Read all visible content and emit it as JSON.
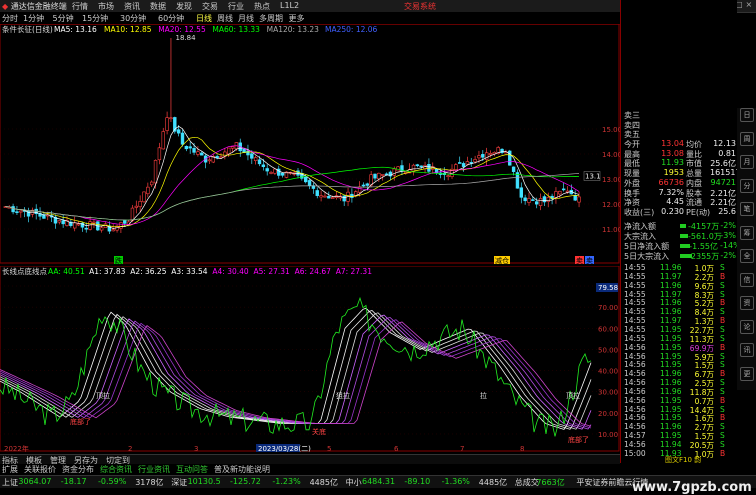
{
  "app": {
    "title": "通达信金融终端",
    "trade_button": "交易系统"
  },
  "menu": [
    "行情",
    "市场",
    "资讯",
    "数据",
    "发现",
    "交易",
    "行业",
    "热点",
    "L1L2"
  ],
  "periods": [
    "分时",
    "1分钟",
    "5分钟",
    "15分钟",
    "30分钟",
    "60分钟",
    "日线",
    "周线",
    "月线",
    "多周期",
    "更多"
  ],
  "active_period": "日线",
  "main_chart": {
    "title": "条件长征(日线)",
    "ma_labels": [
      {
        "text": "MA5: 13.16",
        "color": "#ffffff"
      },
      {
        "text": "MA10: 12.85",
        "color": "#ffff00"
      },
      {
        "text": "MA20: 12.55",
        "color": "#ff00ff"
      },
      {
        "text": "MA60: 13.33",
        "color": "#00ff00"
      },
      {
        "text": "MA120: 13.23",
        "color": "#aaaaaa"
      },
      {
        "text": "MA250: 12.06",
        "color": "#4060ff"
      }
    ],
    "price_axis": [
      "15.00",
      "14.00",
      "13.00",
      "12.00",
      "11.00"
    ],
    "high_label": "18.84",
    "low_label": "9.79",
    "current_price_tag": "13.1",
    "markers": [
      {
        "text": "跌",
        "color": "#00cc00"
      },
      {
        "text": "减仓",
        "color": "#ffcc00"
      },
      {
        "text": "卖",
        "color": "#ff3333"
      },
      {
        "text": "卖",
        "color": "#3366ff"
      }
    ]
  },
  "indicator": {
    "title": "长线点底线点",
    "labels": [
      {
        "text": "AA: 40.51",
        "color": "#00ff00"
      },
      {
        "text": "A1: 37.83",
        "color": "#ffffff"
      },
      {
        "text": "A2: 36.25",
        "color": "#ffffff"
      },
      {
        "text": "A3: 33.54",
        "color": "#ffffff"
      },
      {
        "text": "A4: 30.40",
        "color": "#ff00ff"
      },
      {
        "text": "A5: 27.31",
        "color": "#ff00ff"
      },
      {
        "text": "A6: 24.67",
        "color": "#ff00ff"
      },
      {
        "text": "A7: 27.31",
        "color": "#ff00ff"
      }
    ],
    "axis": [
      "80.00",
      "70.00",
      "60.00",
      "50.00",
      "40.00",
      "30.00",
      "20.00",
      "10.00"
    ],
    "value_tag": "79.58",
    "annotations": [
      "顶拉",
      "狙拉",
      "拉",
      "顶拉",
      "底部了",
      "关底",
      "底部了"
    ]
  },
  "time_axis": [
    "2022年",
    "2",
    "3",
    "4",
    "2023/03/28(二)",
    "5",
    "6",
    "7",
    "8"
  ],
  "right_panel": {
    "order_book": [
      "卖三",
      "卖四",
      "卖五"
    ],
    "quote": [
      {
        "l": "今开",
        "v1": "13.04",
        "c1": "red",
        "l2": "均价",
        "v2": "12.13",
        "c2": "white"
      },
      {
        "l": "最高",
        "v1": "13.08",
        "c1": "red",
        "l2": "量比",
        "v2": "0.81",
        "c2": "white"
      },
      {
        "l": "最低",
        "v1": "11.93",
        "c1": "green",
        "l2": "市值",
        "v2": "25.6亿",
        "c2": "white"
      },
      {
        "l": "现量",
        "v1": "1953",
        "c1": "yellow",
        "l2": "总量",
        "v2": "161517",
        "c2": "white"
      },
      {
        "l": "外盘",
        "v1": "66736",
        "c1": "red",
        "l2": "内盘",
        "v2": "94721",
        "c2": "green"
      },
      {
        "l": "换手",
        "v1": "7.32%",
        "c1": "white",
        "l2": "股本",
        "v2": "2.21亿",
        "c2": "white"
      },
      {
        "l": "净资",
        "v1": "4.45",
        "c1": "white",
        "l2": "流通",
        "v2": "2.21亿",
        "c2": "white"
      },
      {
        "l": "收益(三)",
        "v1": "0.230",
        "c1": "white",
        "l2": "PE(动)",
        "v2": "25.6",
        "c2": "white"
      }
    ],
    "capital": [
      {
        "l": "净流入额",
        "v": "-4157万",
        "p": "-2%"
      },
      {
        "l": "大宗流入",
        "v": "-561.0万",
        "p": "-3%"
      },
      {
        "l": "5日净流入额",
        "v": "-1.55亿",
        "p": "-14%"
      },
      {
        "l": "5日大宗流入",
        "v": "-2355万",
        "p": "-2%"
      }
    ],
    "ticks": [
      {
        "t": "14:55",
        "p": "11.96",
        "v": "1.0万",
        "d": "S"
      },
      {
        "t": "14:55",
        "p": "11.97",
        "v": "2.2万",
        "d": "B"
      },
      {
        "t": "14:55",
        "p": "11.96",
        "v": "9.6万",
        "d": "S"
      },
      {
        "t": "14:55",
        "p": "11.97",
        "v": "8.3万",
        "d": "S"
      },
      {
        "t": "14:55",
        "p": "11.96",
        "v": "5.2万",
        "d": "B"
      },
      {
        "t": "14:55",
        "p": "11.96",
        "v": "8.4万",
        "d": "S"
      },
      {
        "t": "14:55",
        "p": "11.97",
        "v": "1.3万",
        "d": "B"
      },
      {
        "t": "14:55",
        "p": "11.95",
        "v": "22.7万",
        "d": "S"
      },
      {
        "t": "14:55",
        "p": "11.95",
        "v": "11.3万",
        "d": "S"
      },
      {
        "t": "14:56",
        "p": "11.95",
        "v": "69.9万",
        "d": "B"
      },
      {
        "t": "14:56",
        "p": "11.95",
        "v": "5.9万",
        "d": "S"
      },
      {
        "t": "14:56",
        "p": "11.95",
        "v": "1.5万",
        "d": "S"
      },
      {
        "t": "14:56",
        "p": "11.96",
        "v": "6.7万",
        "d": "B"
      },
      {
        "t": "14:56",
        "p": "11.96",
        "v": "2.5万",
        "d": "S"
      },
      {
        "t": "14:56",
        "p": "11.96",
        "v": "11.8万",
        "d": "S"
      },
      {
        "t": "14:56",
        "p": "11.95",
        "v": "0.7万",
        "d": "B"
      },
      {
        "t": "14:56",
        "p": "11.95",
        "v": "14.4万",
        "d": "S"
      },
      {
        "t": "14:56",
        "p": "11.95",
        "v": "1.6万",
        "d": "B"
      },
      {
        "t": "14:56",
        "p": "11.96",
        "v": "2.7万",
        "d": "S"
      },
      {
        "t": "14:57",
        "p": "11.95",
        "v": "1.5万",
        "d": "S"
      },
      {
        "t": "14:56",
        "p": "11.94",
        "v": "20.5万",
        "d": "S"
      },
      {
        "t": "15:00",
        "p": "11.93",
        "v": "1.0万",
        "d": "B"
      }
    ],
    "bottom_label": "图文F10 韵"
  },
  "side_buttons": [
    "日",
    "周",
    "月",
    "分",
    "笔",
    "筹",
    "全",
    "信",
    "资",
    "论",
    "讯",
    "更"
  ],
  "tabs": [
    "指标",
    "模板",
    "管理",
    "另存为",
    "切定到"
  ],
  "func_tabs": [
    "扩展",
    "关联报价",
    "资金分布",
    "综合资讯",
    "行业资讯",
    "互动问答",
    "普及新功能说明"
  ],
  "indices": [
    {
      "name": "上证",
      "value": "3064.07",
      "chg": "-18.17",
      "pct": "-0.59%",
      "amt": "3178亿"
    },
    {
      "name": "深证",
      "value": "10130.5",
      "chg": "-125.72",
      "pct": "-1.23%",
      "amt": "4485亿"
    },
    {
      "name": "中小",
      "value": "6484.31",
      "chg": "-89.10",
      "pct": "-1.36%",
      "amt": "4485亿"
    },
    {
      "name": "总成交",
      "value": "7663亿",
      "chg": "",
      "pct": "",
      "amt": ""
    }
  ],
  "status_text": "平安证券前瞻云行情",
  "watermark": "www.7gpzb.com"
}
